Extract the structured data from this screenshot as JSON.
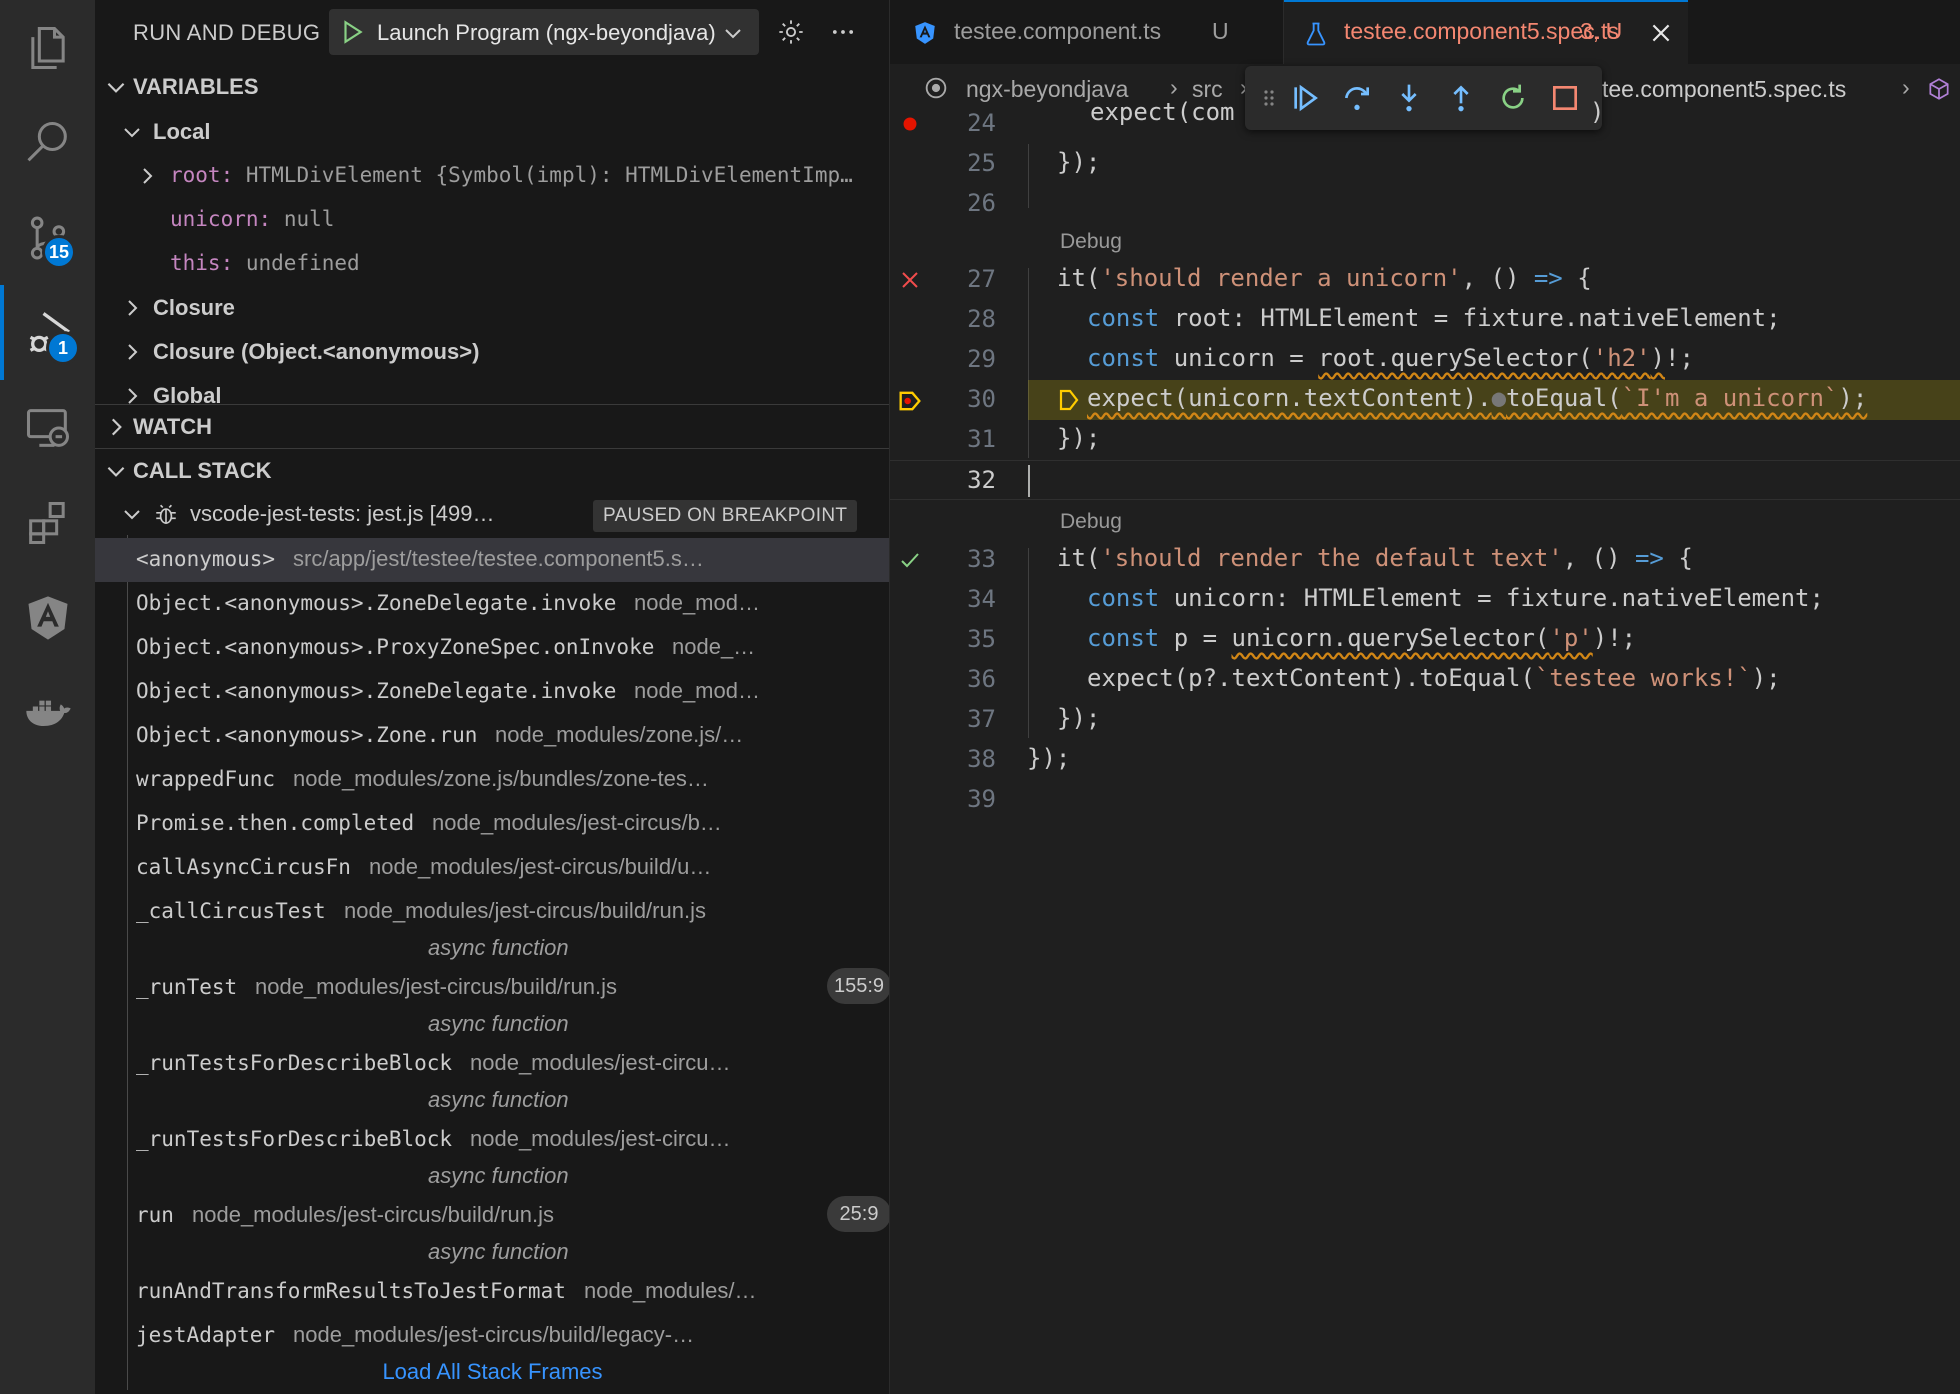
{
  "activity": {
    "source_control_badge": "15",
    "debug_badge": "1",
    "colors": {
      "accent": "#0078d4"
    }
  },
  "sidebar": {
    "title": "RUN AND DEBUG",
    "launch_config": "Launch Program (ngx-beyondjava)",
    "variables": {
      "header": "VARIABLES",
      "scope_local": "Local",
      "locals": [
        {
          "name": "root:",
          "value": "HTMLDivElement {Symbol(impl): HTMLDivElementImp…"
        },
        {
          "name": "unicorn:",
          "value": "null"
        },
        {
          "name": "this:",
          "value": "undefined"
        }
      ],
      "scopes": [
        "Closure",
        "Closure (Object.<anonymous>)",
        "Global"
      ]
    },
    "watch": {
      "header": "WATCH"
    },
    "call_stack": {
      "header": "CALL STACK",
      "session": "vscode-jest-tests: jest.js [499…",
      "status": "PAUSED ON BREAKPOINT",
      "frames": [
        {
          "fn": "<anonymous>",
          "path": "src/app/jest/testee/testee.component5.s…"
        },
        {
          "fn": "Object.<anonymous>.ZoneDelegate.invoke",
          "path": "node_mod…"
        },
        {
          "fn": "Object.<anonymous>.ProxyZoneSpec.onInvoke",
          "path": "node_…"
        },
        {
          "fn": "Object.<anonymous>.ZoneDelegate.invoke",
          "path": "node_mod…"
        },
        {
          "fn": "Object.<anonymous>.Zone.run",
          "path": "node_modules/zone.js/…"
        },
        {
          "fn": "wrappedFunc",
          "path": "node_modules/zone.js/bundles/zone-tes…"
        },
        {
          "fn": "Promise.then.completed",
          "path": "node_modules/jest-circus/b…"
        },
        {
          "fn": "callAsyncCircusFn",
          "path": "node_modules/jest-circus/build/u…"
        },
        {
          "fn": "_callCircusTest",
          "path": "node_modules/jest-circus/build/run.js"
        },
        {
          "fn": "_runTest",
          "path": "node_modules/jest-circus/build/run.js",
          "line": "155:9"
        },
        {
          "fn": "_runTestsForDescribeBlock",
          "path": "node_modules/jest-circu…"
        },
        {
          "fn": "_runTestsForDescribeBlock",
          "path": "node_modules/jest-circu…"
        },
        {
          "fn": "run",
          "path": "node_modules/jest-circus/build/run.js",
          "line": "25:9"
        },
        {
          "fn": "runAndTransformResultsToJestFormat",
          "path": "node_modules/…"
        },
        {
          "fn": "jestAdapter",
          "path": "node_modules/jest-circus/build/legacy-…"
        }
      ],
      "async_label": "async function",
      "load_all": "Load All Stack Frames"
    }
  },
  "editor": {
    "tabs": [
      {
        "name": "testee.component.ts",
        "status": "U"
      },
      {
        "name": "testee.component5.spec.ts",
        "status": "3, U"
      }
    ],
    "breadcrumbs": [
      "ngx-beyondjava",
      "src",
      "tee.component5.spec.ts"
    ],
    "code_lens": "Debug",
    "line_numbers": [
      "24",
      "25",
      "26",
      "27",
      "28",
      "29",
      "30",
      "31",
      "32",
      "33",
      "34",
      "35",
      "36",
      "37",
      "38",
      "39"
    ],
    "line24": "expect(com",
    "line24_tail": ")",
    "line25": "});",
    "line27_a": "it(",
    "line27_s": "'should render a unicorn'",
    "line27_b": ", () ",
    "line27_arrow": "=>",
    "line27_c": " {",
    "line28_k": "const",
    "line28_a": " root: HTMLElement = fixture.nativeElement;",
    "line29_k": "const",
    "line29_a": " unicorn = ",
    "line29_call": "root.querySelector(",
    "line29_s": "'h2'",
    "line29_b": ")",
    "line29_c": "!;",
    "line30_a": "expect(unicorn.textContent).",
    "line30_b": "toEqual(",
    "line30_s": "`I'm a unicorn`",
    "line30_c": ");",
    "line31": "});",
    "line33_a": "it(",
    "line33_s": "'should render the default text'",
    "line33_b": ", () ",
    "line33_arrow": "=>",
    "line33_c": " {",
    "line34_k": "const",
    "line34_a": " unicorn: HTMLElement = fixture.nativeElement;",
    "line35_k": "const",
    "line35_a": " p = ",
    "line35_call": "unicorn.querySelector(",
    "line35_s": "'p'",
    "line35_b": ")!;",
    "line36_a": "expect(p?.textContent).toEqual(",
    "line36_s": "`testee works!`",
    "line36_b": ");",
    "line37": "});",
    "line38": "});",
    "colors": {
      "string": "#ce9178",
      "keyword": "#569cd6",
      "paused_line": "#4b4b1e",
      "error": "#f14c4c",
      "pass": "#89d185",
      "modified_tab": "#f48771"
    }
  }
}
